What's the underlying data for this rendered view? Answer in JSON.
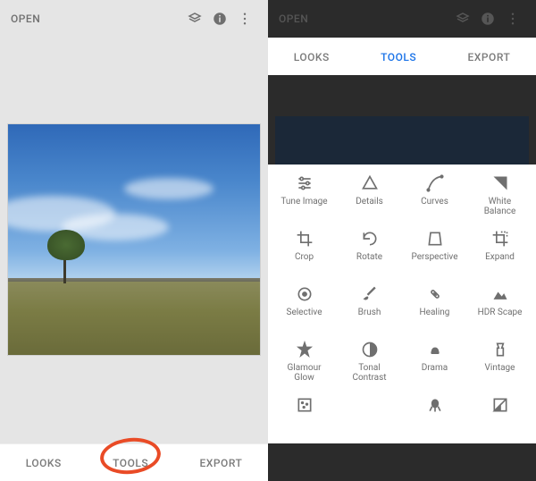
{
  "left": {
    "open_label": "OPEN",
    "tabs": {
      "looks": "LOOKS",
      "tools": "TOOLS",
      "export": "EXPORT"
    }
  },
  "right": {
    "open_label": "OPEN",
    "tabs": {
      "looks": "LOOKS",
      "tools": "TOOLS",
      "export": "EXPORT"
    },
    "tools": [
      {
        "id": "tune-image",
        "label": "Tune Image"
      },
      {
        "id": "details",
        "label": "Details"
      },
      {
        "id": "curves",
        "label": "Curves"
      },
      {
        "id": "white-balance",
        "label": "White\nBalance"
      },
      {
        "id": "crop",
        "label": "Crop"
      },
      {
        "id": "rotate",
        "label": "Rotate"
      },
      {
        "id": "perspective",
        "label": "Perspective"
      },
      {
        "id": "expand",
        "label": "Expand"
      },
      {
        "id": "selective",
        "label": "Selective"
      },
      {
        "id": "brush",
        "label": "Brush"
      },
      {
        "id": "healing",
        "label": "Healing"
      },
      {
        "id": "hdr-scape",
        "label": "HDR Scape"
      },
      {
        "id": "glamour-glow",
        "label": "Glamour\nGlow"
      },
      {
        "id": "tonal-contrast",
        "label": "Tonal\nContrast"
      },
      {
        "id": "drama",
        "label": "Drama"
      },
      {
        "id": "vintage",
        "label": "Vintage"
      },
      {
        "id": "grainy-film",
        "label": ""
      },
      {
        "id": "retrolux",
        "label": ""
      },
      {
        "id": "grunge",
        "label": ""
      },
      {
        "id": "black-white",
        "label": ""
      }
    ]
  },
  "icons": {
    "undo_stack": "layers",
    "info": "info",
    "more": "more"
  }
}
